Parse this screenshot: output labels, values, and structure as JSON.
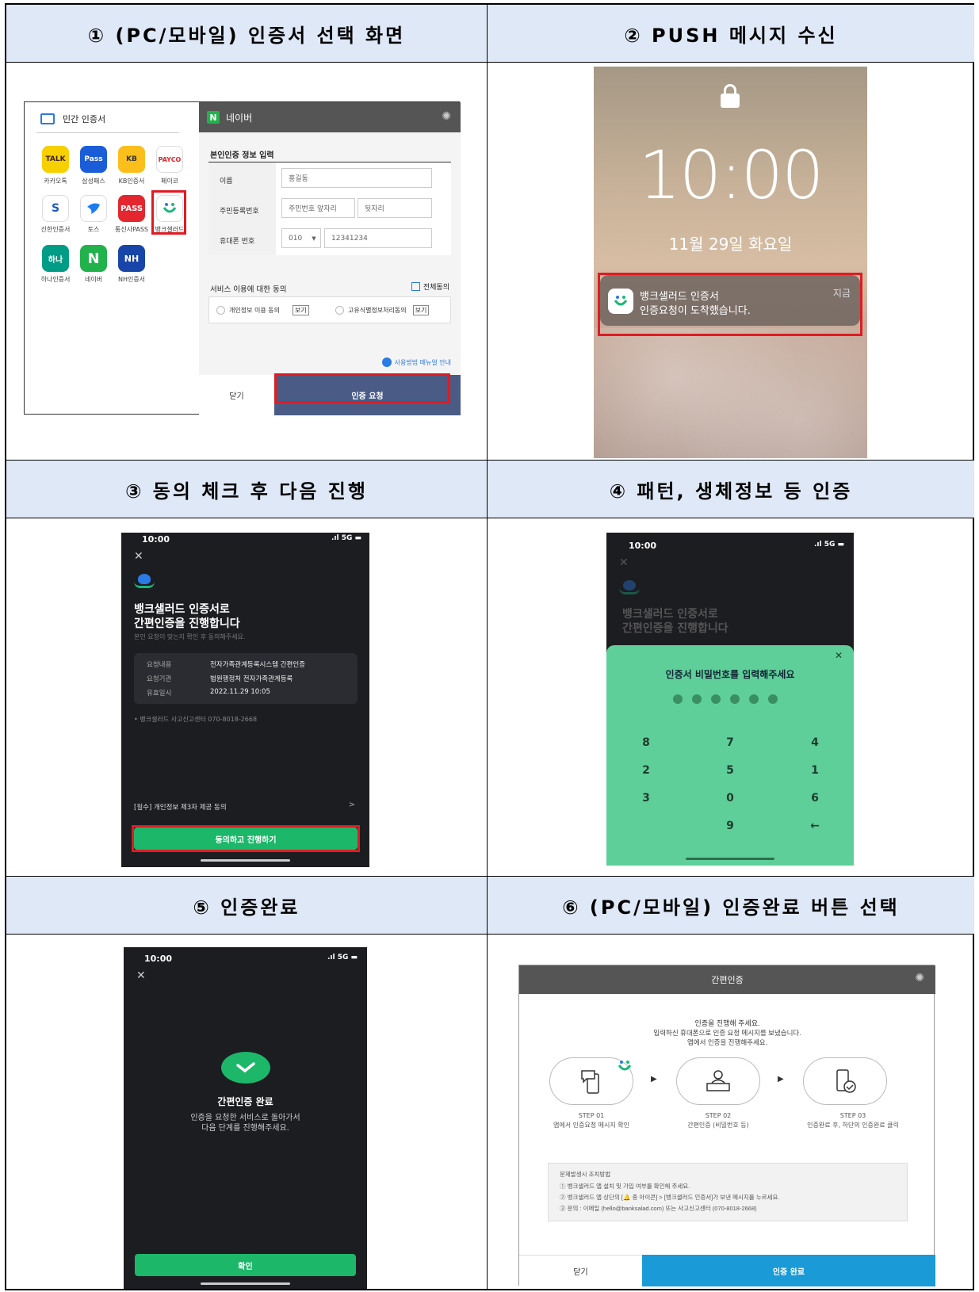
{
  "headers": {
    "h1": "① (PC/모바일) 인증서 선택 화면",
    "h2": "② PUSH 메시지 수신",
    "h3": "③ 동의 체크 후 다음 진행",
    "h4": "④ 패턴, 생체정보 등 인증",
    "h5": "⑤ 인증완료",
    "h6": "⑥ (PC/모바일) 인증완료 버튼 선택"
  },
  "panel1": {
    "left_title": "민간 인증서",
    "apps": [
      {
        "icon": "TALK",
        "label": "카카오톡"
      },
      {
        "icon": "Pass",
        "label": "삼성패스"
      },
      {
        "icon": "KB",
        "label": "KB인증서"
      },
      {
        "icon": "PAYCO",
        "label": "페이코"
      },
      {
        "icon": "S",
        "label": "신한인증서"
      },
      {
        "icon": "toss",
        "label": "토스"
      },
      {
        "icon": "PASS",
        "label": "통신사PASS"
      },
      {
        "icon": "banksalad",
        "label": "뱅크샐러드"
      },
      {
        "icon": "하나",
        "label": "하나인증서"
      },
      {
        "icon": "N",
        "label": "네이버"
      },
      {
        "icon": "NH",
        "label": "NH인증서"
      }
    ],
    "provider": "네이버",
    "section_title": "본인인증 정보 입력",
    "name_label": "이름",
    "name_value": "홍길동",
    "rrn_label": "주민등록번호",
    "rrn_front": "주민번호 앞자리",
    "rrn_back": "뒷자리",
    "phone_label": "휴대폰 번호",
    "phone_prefix": "010",
    "phone_number": "12341234",
    "consent_title": "서비스 이용에 대한 동의",
    "agree_all": "전체동의",
    "consent1": "개인정보 이용 동의",
    "consent2": "고유식별정보처리동의",
    "view": "보기",
    "manual": "사용방법 매뉴얼 안내",
    "close": "닫기",
    "request": "인증 요청"
  },
  "panel2": {
    "time": "10:00",
    "date": "11월 29일 화요일",
    "notif_title": "뱅크샐러드 인증서",
    "notif_body": "인증요청이 도착했습니다.",
    "notif_time": "지금"
  },
  "panel3": {
    "time": "10:00",
    "signal": "5G",
    "title1": "뱅크샐러드 인증서로",
    "title2": "간편인증을 진행합니다",
    "subtitle": "본인 요청이 맞는지 확인 후 동의해주세요.",
    "rows": [
      {
        "k": "요청내용",
        "v": "전자가족관계등록시스템 간편인증"
      },
      {
        "k": "요청기관",
        "v": "법원행정처 전자가족관계등록"
      },
      {
        "k": "유효일시",
        "v": "2022.11.29 10:05"
      }
    ],
    "report": "• 뱅크샐러드 사고신고센터 070-8018-2668",
    "consent": "[필수] 개인정보 제3자 제공 동의",
    "consent_arrow": ">",
    "button": "동의하고 진행하기"
  },
  "panel4": {
    "time": "10:00",
    "signal": "5G",
    "title1": "뱅크샐러드 인증서로",
    "title2": "간편인증을 진행합니다",
    "prompt": "인증서 비밀번호를 입력해주세요",
    "keys": [
      "8",
      "7",
      "4",
      "2",
      "5",
      "1",
      "3",
      "0",
      "6",
      "",
      "9",
      "←"
    ]
  },
  "panel5": {
    "time": "10:00",
    "signal": "5G",
    "title": "간편인증 완료",
    "desc1": "인증을 요청한 서비스로 돌아가서",
    "desc2": "다음 단계를 진행해주세요.",
    "button": "확인"
  },
  "panel6": {
    "header": "간편인증",
    "line1": "인증을 진행해 주세요.",
    "line2": "입력하신 휴대폰으로 인증 요청 메시지를 보냈습니다.",
    "line3": "앱에서 인증을 진행해주세요.",
    "steps": [
      {
        "no": "STEP 01",
        "desc": "앱에서 인증요청 메시지 확인"
      },
      {
        "no": "STEP 02",
        "desc": "간편인증 (비밀번호 등)"
      },
      {
        "no": "STEP 03",
        "desc": "인증완료 후, 하단의 인증완료 클릭"
      }
    ],
    "help_title": "문제발생시 조치방법",
    "help": [
      "① 뱅크샐러드 앱 설치 및 가입 여부를 확인해 주세요.",
      "② 뱅크샐러드 앱 상단의 [🔔 종 아이콘] > [뱅크샐러드 인증서]가 보낸 메시지를 누르세요.",
      "③ 문의 : 이메일 (hello@banksalad.com) 또는 사고신고센터 (070-8018-2668)"
    ],
    "close": "닫기",
    "complete": "인증 완료"
  },
  "colors": {
    "header_bg": "#dfe8f7",
    "red": "#e01b22",
    "green": "#1db76a",
    "blue": "#1a9ad6"
  }
}
